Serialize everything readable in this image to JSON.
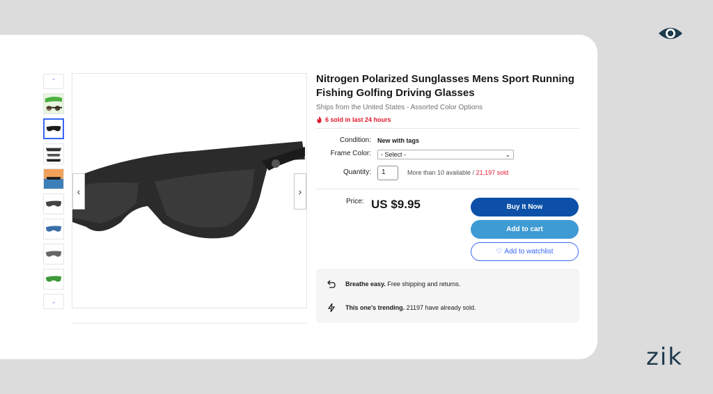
{
  "brand": {
    "name": "zik",
    "eye_icon": "eye-icon"
  },
  "gallery": {
    "thumb_count": 8,
    "selected_index": 1,
    "up_icon": "chevron-up-icon",
    "down_icon": "chevron-down-icon",
    "prev_icon": "chevron-left-icon",
    "next_icon": "chevron-right-icon"
  },
  "product": {
    "title": "Nitrogen Polarized Sunglasses Mens Sport Running Fishing Golfing Driving Glasses",
    "ships_from": "Ships from the United States - Assorted Color Options",
    "sold_recent": "6 sold in last 24 hours",
    "condition_label": "Condition:",
    "condition_value": "New with tags",
    "frame_color_label": "Frame Color:",
    "frame_color_value": "- Select -",
    "quantity_label": "Quantity:",
    "quantity_value": "1",
    "availability": "More than 10 available / ",
    "sold_count": "21,197 sold",
    "price_label": "Price:",
    "price_value": "US $9.95"
  },
  "actions": {
    "buy_now": "Buy It Now",
    "add_to_cart": "Add to cart",
    "add_to_watchlist": "Add to watchlist"
  },
  "promos": [
    {
      "icon": "return-arrow-icon",
      "bold": "Breathe easy.",
      "text": " Free shipping and returns."
    },
    {
      "icon": "lightning-icon",
      "bold": "This one's trending.",
      "text": " 21197 have already sold."
    }
  ],
  "colors": {
    "buy_now": "#0c50a8",
    "add_to_cart": "#3f9bd4",
    "accent": "#3665f3",
    "alert_red": "#e0182b"
  }
}
